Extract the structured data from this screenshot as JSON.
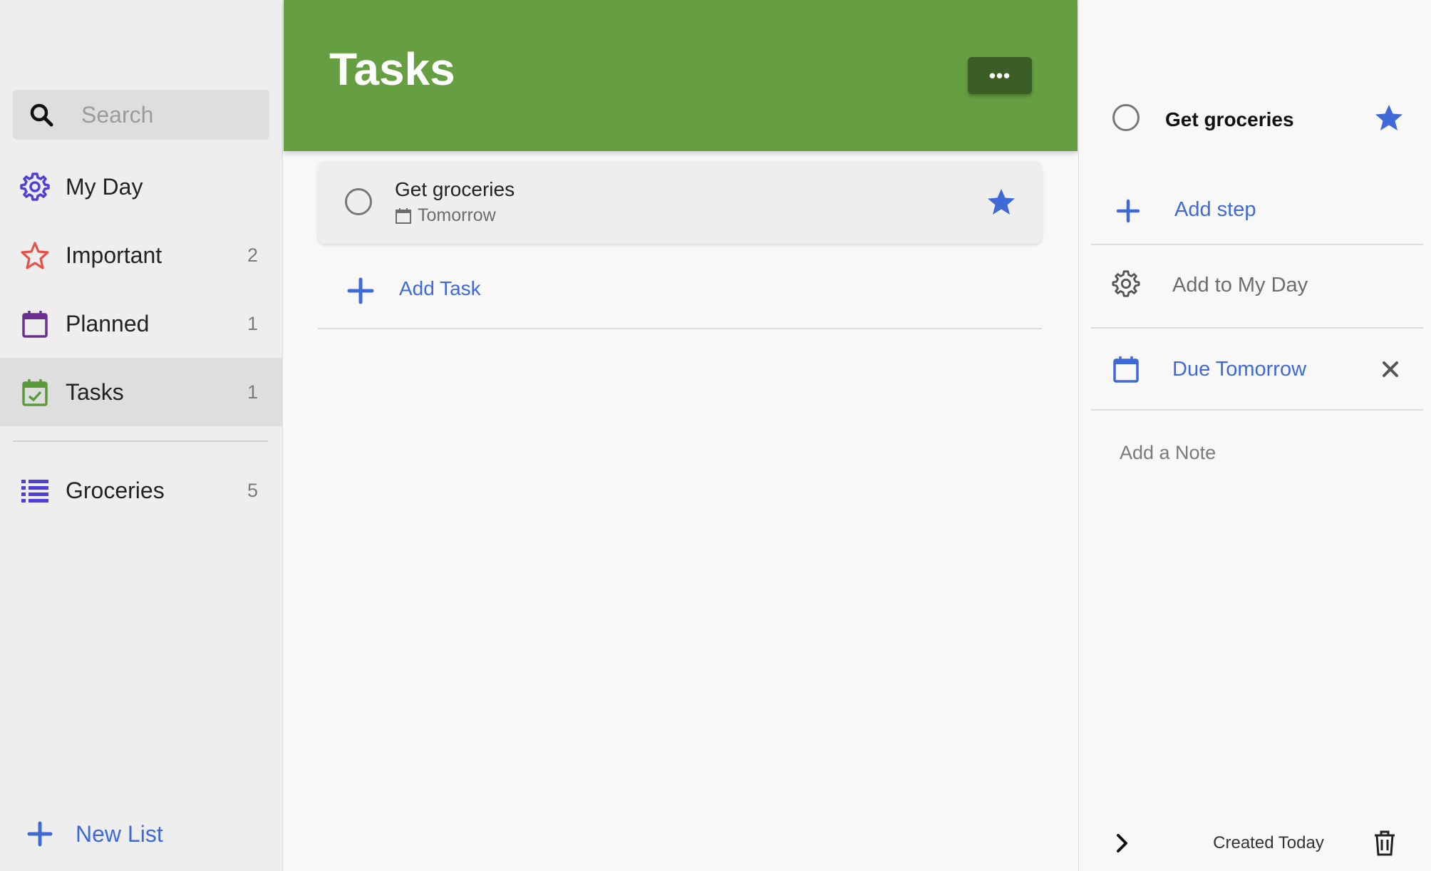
{
  "sidebar": {
    "search": {
      "placeholder": "Search"
    },
    "items": [
      {
        "label": "My Day",
        "count": "",
        "icon": "gear-icon",
        "color": "#4f3fd6"
      },
      {
        "label": "Important",
        "count": "2",
        "icon": "star-outline-icon",
        "color": "#e5524a"
      },
      {
        "label": "Planned",
        "count": "1",
        "icon": "calendar-icon",
        "color": "#6c2f8f"
      },
      {
        "label": "Tasks",
        "count": "1",
        "icon": "calendar-check-icon",
        "color": "#5a9a3a",
        "active": true
      }
    ],
    "lists": [
      {
        "label": "Groceries",
        "count": "5",
        "icon": "list-icon",
        "color": "#4f3fd6"
      }
    ],
    "new_list_label": "New List"
  },
  "main": {
    "title": "Tasks",
    "header_color": "#659f41",
    "more_label": "•••",
    "tasks": [
      {
        "name": "Get groceries",
        "due": "Tomorrow",
        "starred": true
      }
    ],
    "add_task_label": "Add Task"
  },
  "detail": {
    "title": "Get groceries",
    "add_step_label": "Add step",
    "add_my_day_label": "Add to My Day",
    "due_label": "Due Tomorrow",
    "note_placeholder": "Add a Note",
    "created_label": "Created Today"
  },
  "colors": {
    "accent_blue": "#3f69d6",
    "star_blue": "#3f69d6"
  }
}
